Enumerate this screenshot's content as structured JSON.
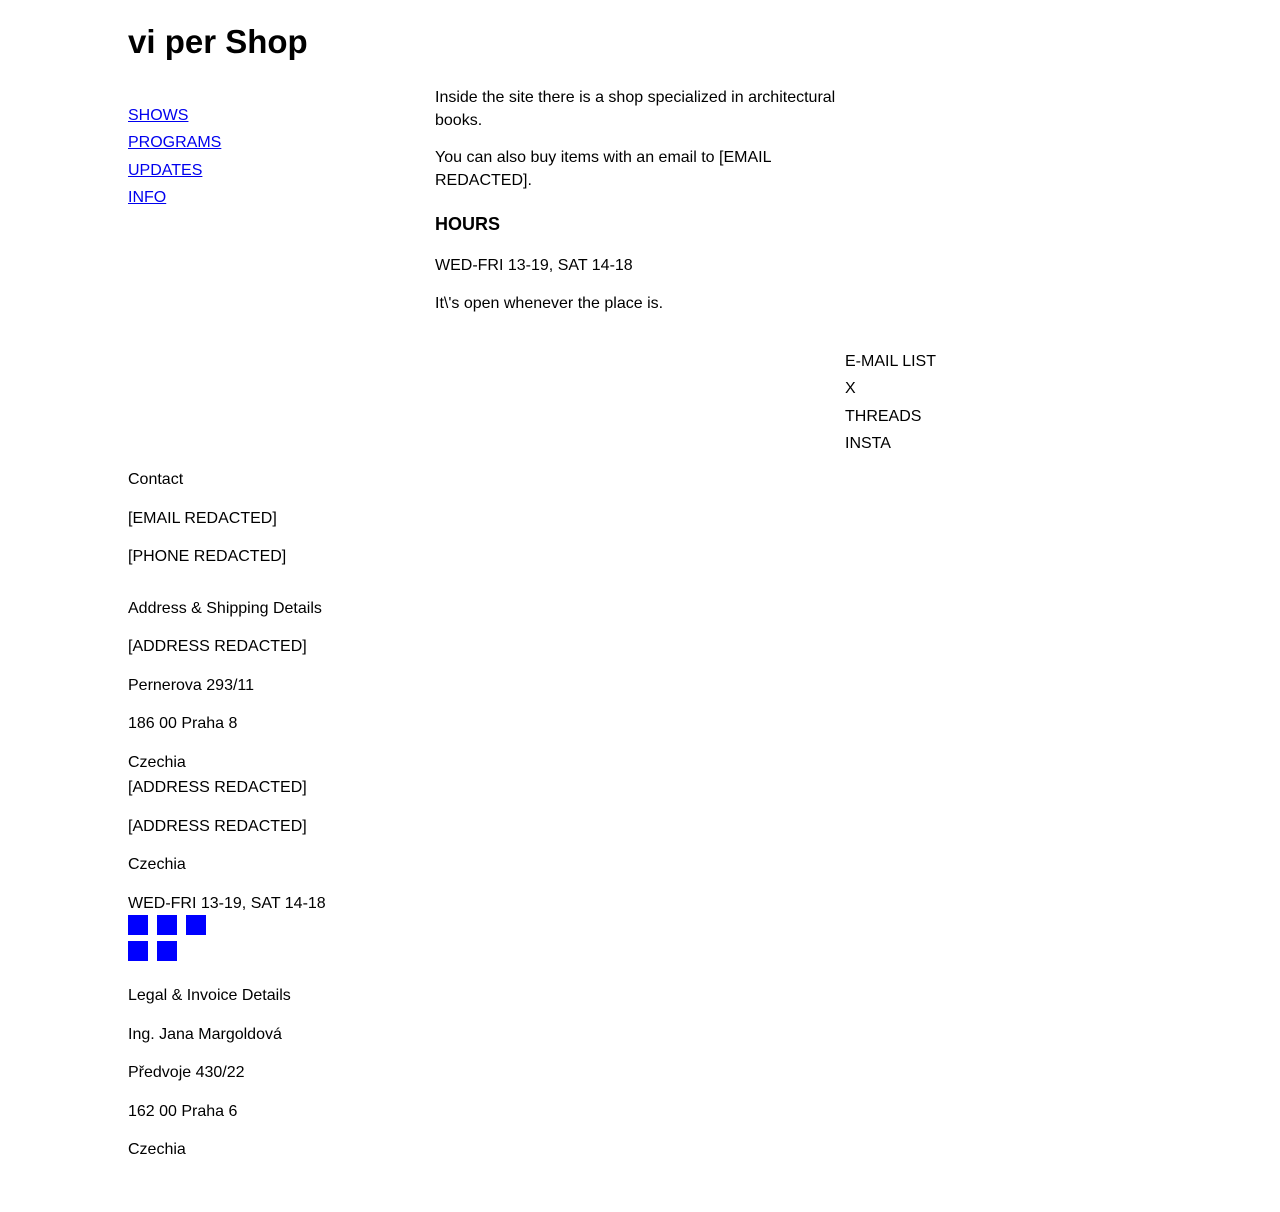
{
  "site": {
    "title": "vi per Shop"
  },
  "nav": {
    "items": [
      {
        "label": "SHOWS"
      },
      {
        "label": "PROGRAMS"
      },
      {
        "label": "UPDATES"
      },
      {
        "label": "INFO"
      }
    ]
  },
  "content": {
    "intro": "Inside the site there is a shop specialized in architectural books.",
    "email_note": "You can also buy items with an email to [EMAIL REDACTED].",
    "hours_heading": "HOURS",
    "hours": "WED-FRI 13-19, SAT 14-18",
    "open_note": "It\\'s open whenever the place is."
  },
  "social": {
    "items": [
      {
        "label": "E-MAIL LIST"
      },
      {
        "label": "X"
      },
      {
        "label": "THREADS"
      },
      {
        "label": "INSTA"
      }
    ]
  },
  "footer": {
    "contact": {
      "heading": "Contact",
      "email": "[EMAIL REDACTED]",
      "phone": "[PHONE REDACTED]"
    },
    "address": {
      "heading": "Address & Shipping Details",
      "lines": [
        "[ADDRESS REDACTED]",
        "Pernerova 293/11",
        "186 00 Praha 8",
        "Czechia",
        "[ADDRESS REDACTED]",
        "[ADDRESS REDACTED]",
        "Czechia",
        "WED-FRI 13-19, SAT 14-18"
      ]
    },
    "icon_color": "#0000ff",
    "legal": {
      "heading": "Legal & Invoice Details",
      "lines": [
        "Ing. Jana Margoldová",
        "Předvoje 430/22",
        "162 00 Praha 6",
        "Czechia"
      ]
    }
  }
}
